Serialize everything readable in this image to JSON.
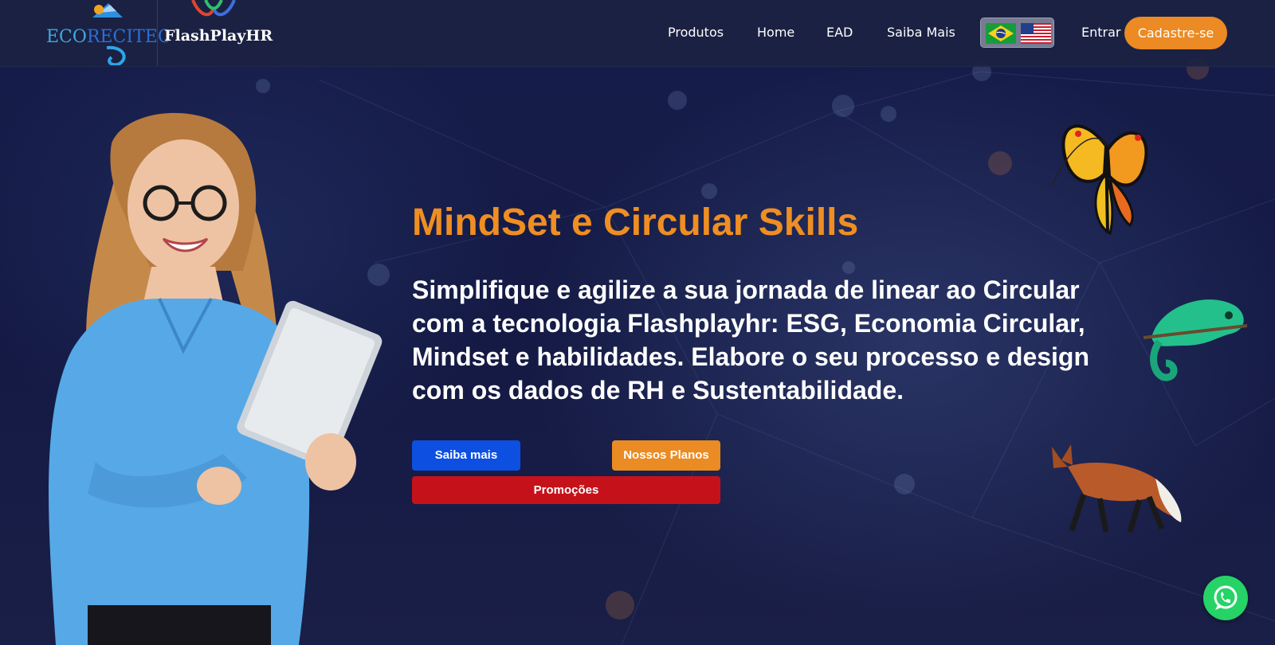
{
  "header": {
    "logo_eco": {
      "part1": "ECO",
      "part2": "RECITEC"
    },
    "logo_fp": "FlashPlayHR",
    "nav": [
      "Produtos",
      "Home",
      "EAD",
      "Saiba Mais"
    ],
    "languages": [
      "pt-BR",
      "en-US"
    ],
    "login_label": "Entrar",
    "signup_label": "Cadastre-se"
  },
  "hero": {
    "title": "MindSet e Circular Skills",
    "description": "Simplifique e agilize a sua jornada de linear ao Circular com a tecnologia Flashplayhr: ESG, Economia Circular, Mindset e habilidades. Elabore o seu processo e design com os dados de RH e Sustentabilidade.",
    "buttons": {
      "saiba_mais": "Saiba mais",
      "nossos_planos": "Nossos Planos",
      "promocoes": "Promoções"
    }
  },
  "colors": {
    "accent_orange": "#ec8a23",
    "primary_blue": "#0d4fe0",
    "promo_red": "#c5121a",
    "background_navy": "#141a44",
    "whatsapp_green": "#25d366"
  },
  "icons": {
    "floating_chat": "whatsapp-icon",
    "flags": [
      "brazil-flag-icon",
      "usa-flag-icon"
    ]
  }
}
